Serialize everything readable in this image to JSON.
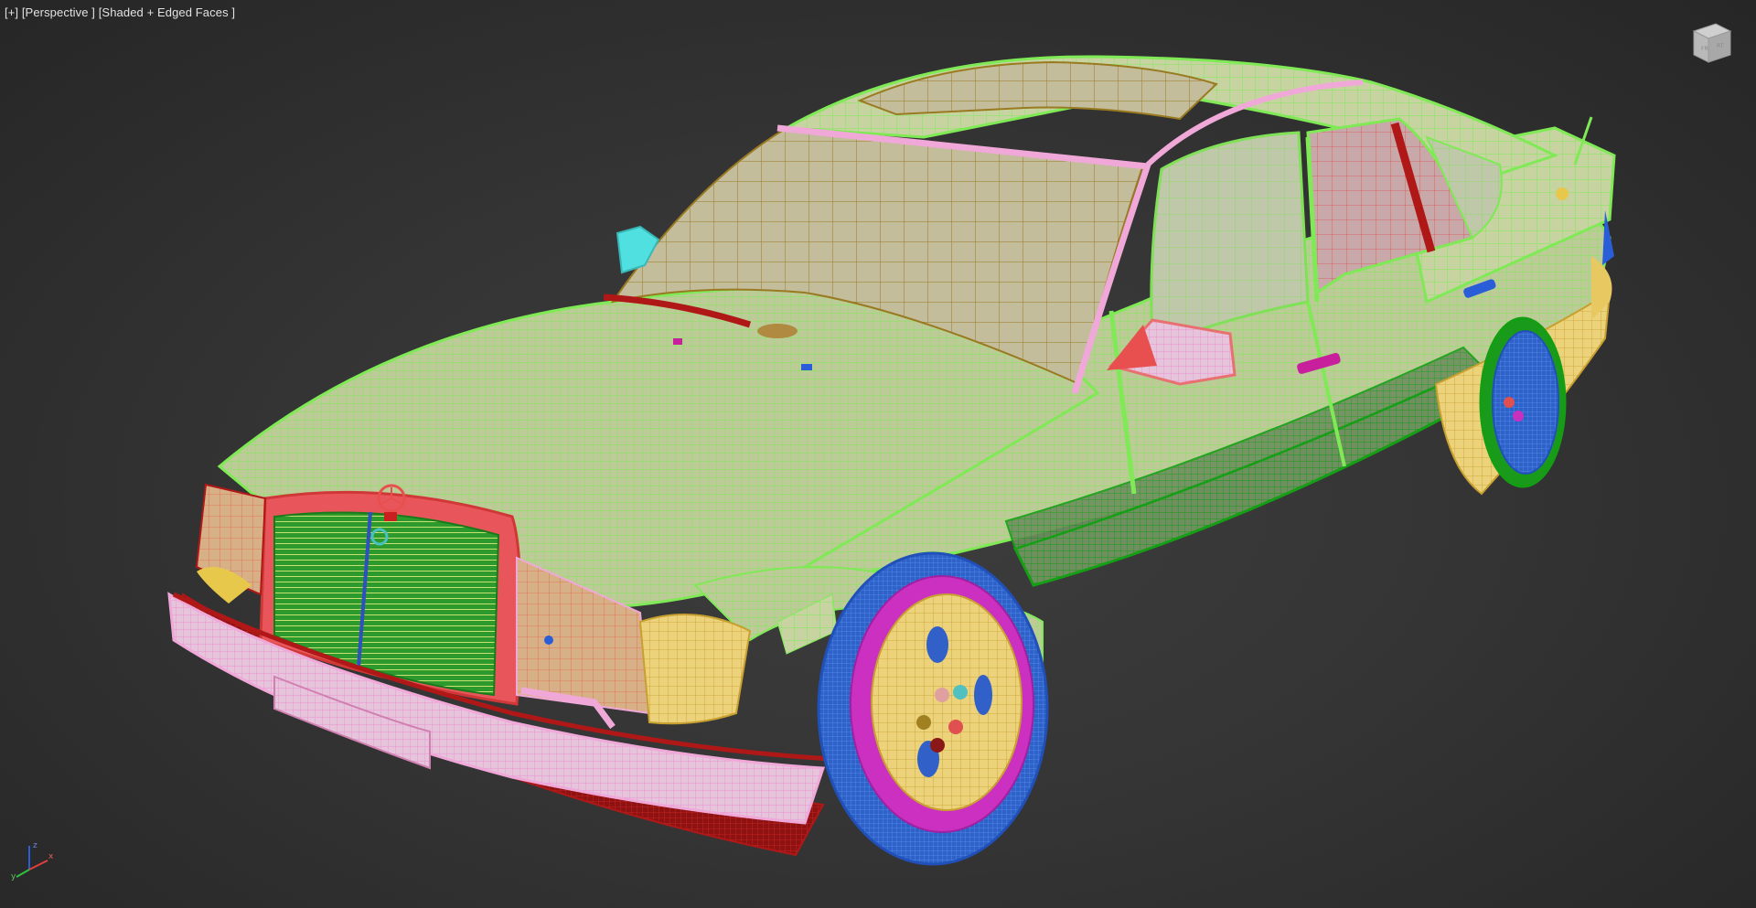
{
  "viewport": {
    "plus_menu": "[+]",
    "view_mode": "[Perspective ]",
    "shading_mode": "[Shaded + Edged Faces ]"
  },
  "viewcube": {
    "icon": "viewcube-icon",
    "front_label": "FR",
    "side_label": "RT"
  },
  "axis_tripod": {
    "x_label": "x",
    "y_label": "y",
    "z_label": "z"
  },
  "colors": {
    "background": "#333333",
    "body_wire": "#7fea55",
    "body_fill": "#c9d6a6",
    "glass_wire": "#9a7a20",
    "glass_fill": "#c8c2a0",
    "grille_frame": "#e8565c",
    "bumper": "#f0a8d8",
    "lower_trim": "#b01818",
    "side_trim": "#18a018",
    "wheel_hub": "#e8c860",
    "wheel_tire": "#2f69d6",
    "wheel_rim": "#cc30c0",
    "mirror": "#50e0e0"
  }
}
